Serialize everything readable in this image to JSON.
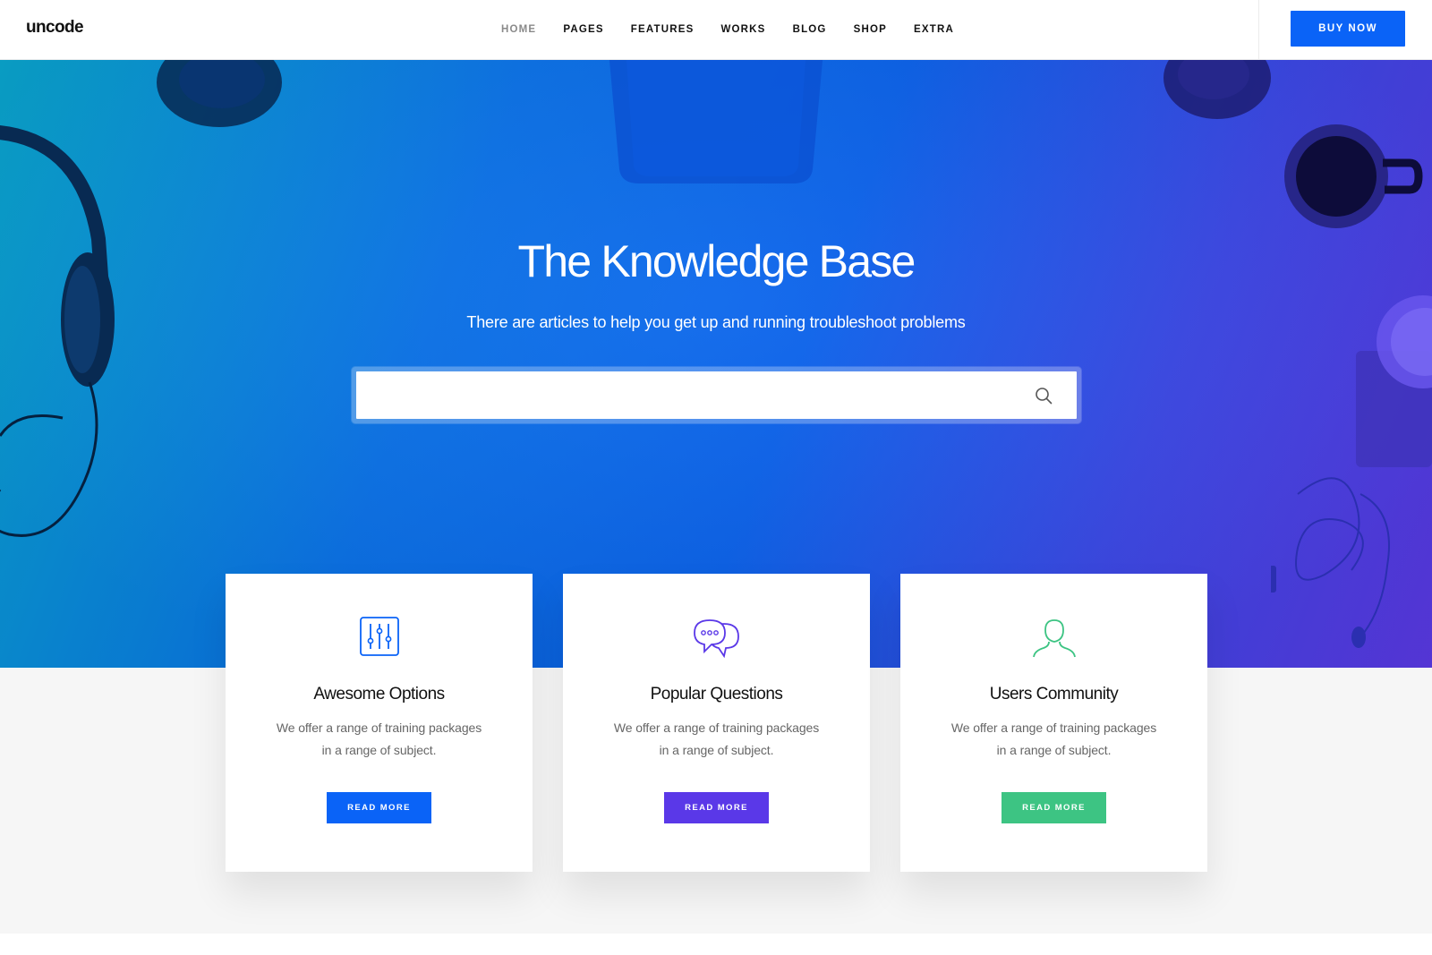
{
  "header": {
    "logo": "uncode",
    "nav": [
      "HOME",
      "PAGES",
      "FEATURES",
      "WORKS",
      "BLOG",
      "SHOP",
      "EXTRA"
    ],
    "active_nav": "HOME",
    "buy_label": "BUY NOW"
  },
  "hero": {
    "title": "The Knowledge Base",
    "subtitle": "There are articles to help you get up and running troubleshoot problems",
    "search": {
      "placeholder": "",
      "value": "",
      "icon": "search-icon"
    }
  },
  "cards": [
    {
      "icon": "sliders-icon",
      "title": "Awesome Options",
      "line1": "We offer a range of training packages",
      "line2": "in a range of subject.",
      "button": "READ MORE",
      "color": "#0a63f7"
    },
    {
      "icon": "chat-bubbles-icon",
      "title": "Popular Questions",
      "line1": "We offer a range of training packages",
      "line2": "in a range of subject.",
      "button": "READ MORE",
      "color": "#5a38e8"
    },
    {
      "icon": "user-icon",
      "title": "Users Community",
      "line1": "We offer a range of training packages",
      "line2": "in a range of subject.",
      "button": "READ MORE",
      "color": "#3dc483"
    }
  ],
  "colors": {
    "accent_blue": "#0a63f7",
    "accent_purple": "#5a38e8",
    "accent_green": "#3dc483",
    "hero_start": "#0aa9d2",
    "hero_end": "#5b39e6"
  }
}
